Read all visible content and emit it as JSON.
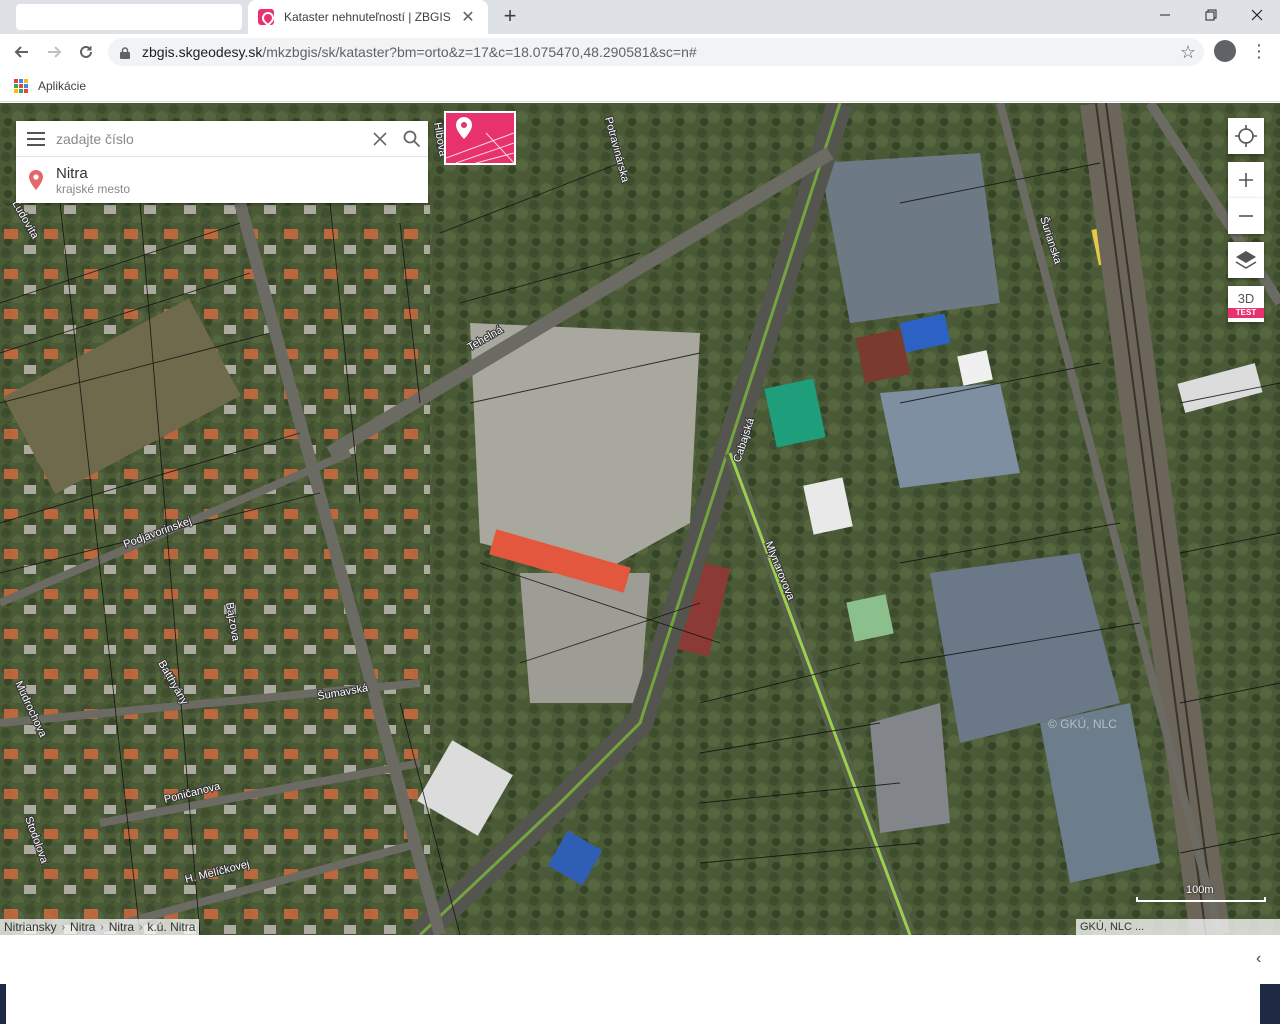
{
  "browser": {
    "tab_title": "Kataster nehnuteľností | ZBGIS",
    "new_tab_symbol": "+",
    "close_symbol": "✕",
    "url_host": "zbgis.skgeodesy.sk",
    "url_path": "/mkzbgis/sk/kataster?bm=orto&z=17&c=18.075470,48.290581&sc=n#",
    "bookmarks_apps_label": "Aplikácie",
    "window_controls": [
      "minimize-icon",
      "restore-icon",
      "close-icon"
    ]
  },
  "search": {
    "placeholder": "zadajte číslo",
    "result_title": "Nitra",
    "result_subtitle": "krajské mesto"
  },
  "controls": {
    "three_d_label": "3D",
    "test_badge": "TEST"
  },
  "map": {
    "street_labels": [
      "Cabajská",
      "Tehelná",
      "Mlynarovova",
      "Šurianska",
      "Podjavorinskej",
      "Šumavská",
      "Poničanova",
      "H. Melíčkovej",
      "Hlbová",
      "Potravinárska",
      "Mudrochova",
      "Bajzova",
      "Stodolova",
      "Batthyány",
      "Ľudovíta"
    ],
    "breadcrumb": [
      "Nitriansky",
      "Nitra",
      "Nitra",
      "k.ú. Nitra"
    ],
    "attribution": "GKÚ, NLC ...",
    "scale_label": "100m",
    "watermark": "© GKÚ, NLC"
  },
  "colors": {
    "brand": "#e8326d",
    "tab_strip": "#dee1e6",
    "omnibox": "#f1f3f4"
  }
}
